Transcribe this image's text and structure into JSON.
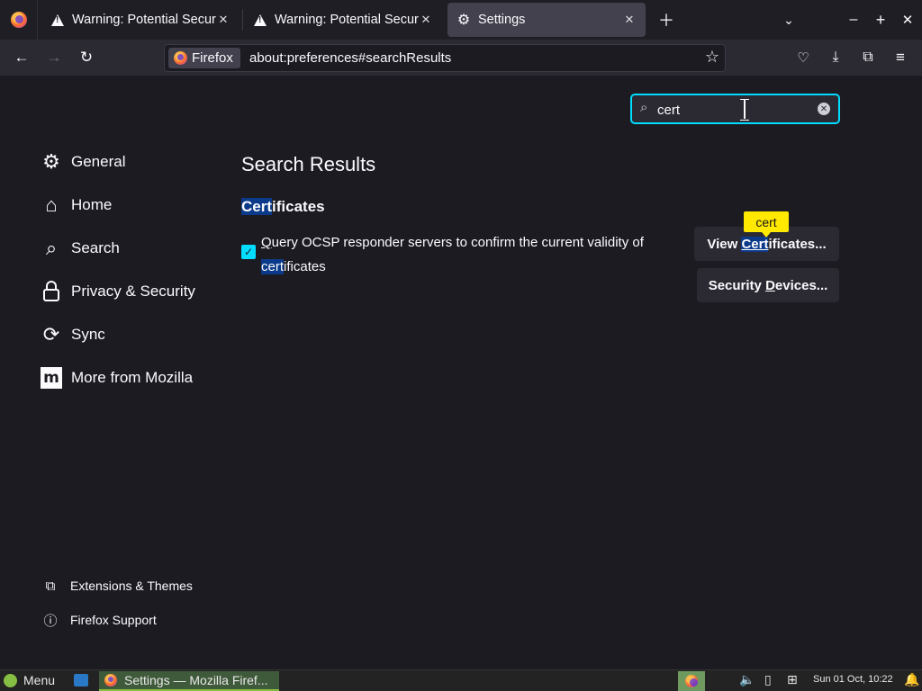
{
  "tabs": [
    {
      "title": "Warning: Potential Security Risk Ahead",
      "icon": "warning-icon"
    },
    {
      "title": "Warning: Potential Security Risk Ahead",
      "icon": "warning-icon"
    },
    {
      "title": "Settings",
      "icon": "gear-icon",
      "active": true
    }
  ],
  "urlbar": {
    "identity": "Firefox",
    "url": "about:preferences#searchResults"
  },
  "search": {
    "value": "cert"
  },
  "sidebar": {
    "items": [
      {
        "label": "General",
        "icon": "gear-icon"
      },
      {
        "label": "Home",
        "icon": "home-icon"
      },
      {
        "label": "Search",
        "icon": "search-icon"
      },
      {
        "label": "Privacy & Security",
        "icon": "lock-icon"
      },
      {
        "label": "Sync",
        "icon": "sync-icon"
      },
      {
        "label": "More from Mozilla",
        "icon": "mozilla-icon"
      }
    ],
    "footer": [
      {
        "label": "Extensions & Themes",
        "icon": "puzzle-icon"
      },
      {
        "label": "Firefox Support",
        "icon": "help-icon"
      }
    ]
  },
  "results": {
    "title": "Search Results",
    "section_hl": "Cert",
    "section_rest": "ificates",
    "ocsp_access": "Q",
    "ocsp_text": "uery OCSP responder servers to confirm the current validity of ",
    "ocsp_hl": "cert",
    "ocsp_rest": "ificates",
    "ocsp_checked": true,
    "view_pre": "View ",
    "view_hl": "Cert",
    "view_rest": "ificates...",
    "devices_pre": "Security ",
    "devices_access": "D",
    "devices_rest": "evices...",
    "tooltip": "cert"
  },
  "colors": {
    "accent": "#00ddff",
    "highlight": "#0b3a8a",
    "tooltip": "#ffe900",
    "background": "#1c1b22"
  },
  "taskbar": {
    "menu": "Menu",
    "window": "Settings — Mozilla Firef...",
    "clock": "Sun 01 Oct, 10:22"
  }
}
